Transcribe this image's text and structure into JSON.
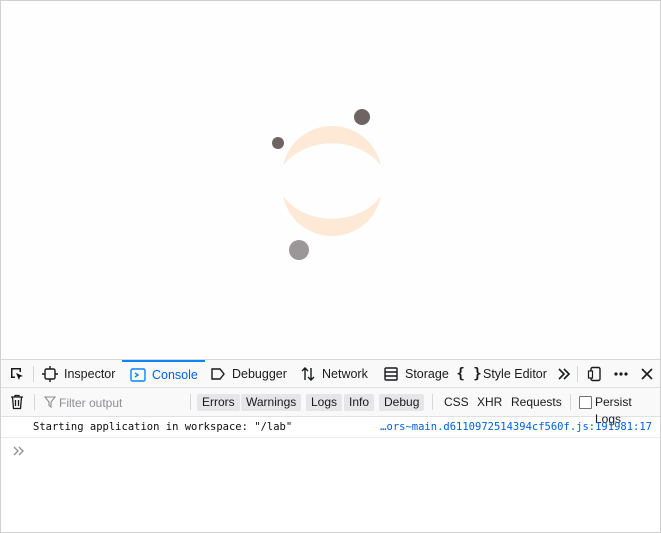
{
  "devtools": {
    "tabs": [
      {
        "label": "Inspector",
        "icon": "inspector-icon"
      },
      {
        "label": "Console",
        "icon": "console-icon",
        "selected": true
      },
      {
        "label": "Debugger",
        "icon": "debugger-icon"
      },
      {
        "label": "Network",
        "icon": "network-icon"
      },
      {
        "label": "Storage",
        "icon": "storage-icon"
      },
      {
        "label": "Style Editor",
        "icon": "style-editor-icon"
      }
    ],
    "accent_color": "#0a84ff"
  },
  "filter": {
    "placeholder": "Filter output",
    "levels": [
      "Errors",
      "Warnings",
      "Logs",
      "Info",
      "Debug"
    ],
    "types": [
      "CSS",
      "XHR",
      "Requests"
    ],
    "persist_logs_label": "Persist Logs",
    "persist_logs_checked": false
  },
  "console": {
    "messages": [
      {
        "text": "Starting application in workspace: \"/lab\"",
        "source": "…ors~main.d6110972514394cf560f.js:191981:17"
      }
    ]
  }
}
